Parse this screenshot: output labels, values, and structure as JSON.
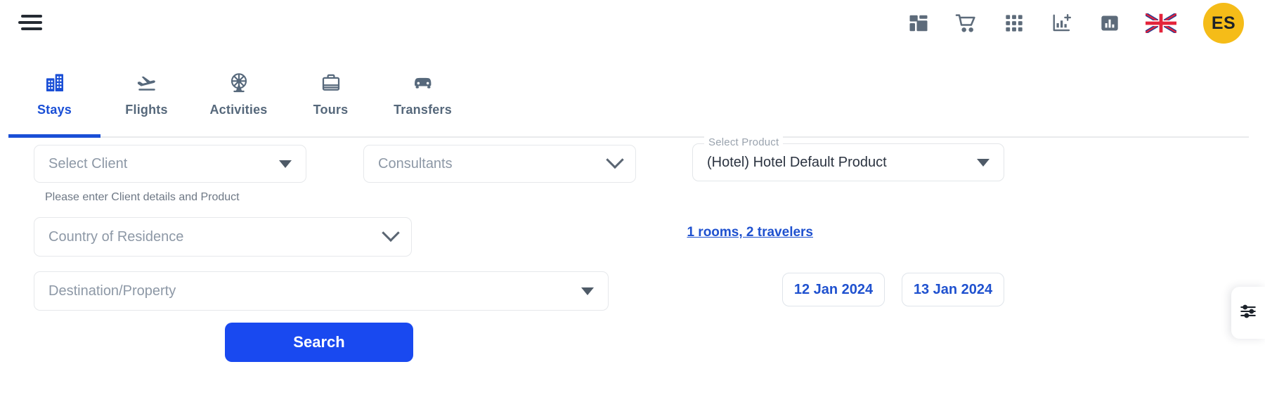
{
  "topbar": {
    "menu_icon": "hamburger-menu-icon",
    "icons": [
      {
        "name": "dashboard-grid-icon",
        "title": "Dashboard"
      },
      {
        "name": "shopping-cart-icon",
        "title": "Cart"
      },
      {
        "name": "apps-grid-icon",
        "title": "Apps"
      },
      {
        "name": "add-report-icon",
        "title": "New Report"
      },
      {
        "name": "bar-chart-icon",
        "title": "Reports"
      },
      {
        "name": "uk-flag-icon",
        "title": "Language"
      }
    ],
    "avatar_initials": "ES"
  },
  "tabs": [
    {
      "label": "Stays",
      "icon": "hotel-building-icon",
      "active": true
    },
    {
      "label": "Flights",
      "icon": "airplane-landing-icon",
      "active": false
    },
    {
      "label": "Activities",
      "icon": "ferris-wheel-icon",
      "active": false
    },
    {
      "label": "Tours",
      "icon": "briefcase-icon",
      "active": false
    },
    {
      "label": "Transfers",
      "icon": "car-icon",
      "active": false
    }
  ],
  "form": {
    "client": {
      "placeholder": "Select Client"
    },
    "consultants": {
      "placeholder": "Consultants"
    },
    "product": {
      "label": "Select Product",
      "value": "(Hotel) Hotel Default Product"
    },
    "helper_text": "Please enter Client details and Product",
    "country": {
      "placeholder": "Country of Residence"
    },
    "destination": {
      "placeholder": "Destination/Property"
    },
    "rooms_travelers": "1 rooms, 2 travelers",
    "date_from": "12 Jan 2024",
    "date_to": "13 Jan 2024",
    "search_label": "Search"
  },
  "filter_tab": {
    "icon": "sliders-filter-icon"
  },
  "colors": {
    "accent_blue": "#1949f0",
    "link_blue": "#1f51cf",
    "tab_active": "#1a4fd6",
    "avatar_yellow": "#f5bc18",
    "muted_text": "#8d98a6"
  }
}
